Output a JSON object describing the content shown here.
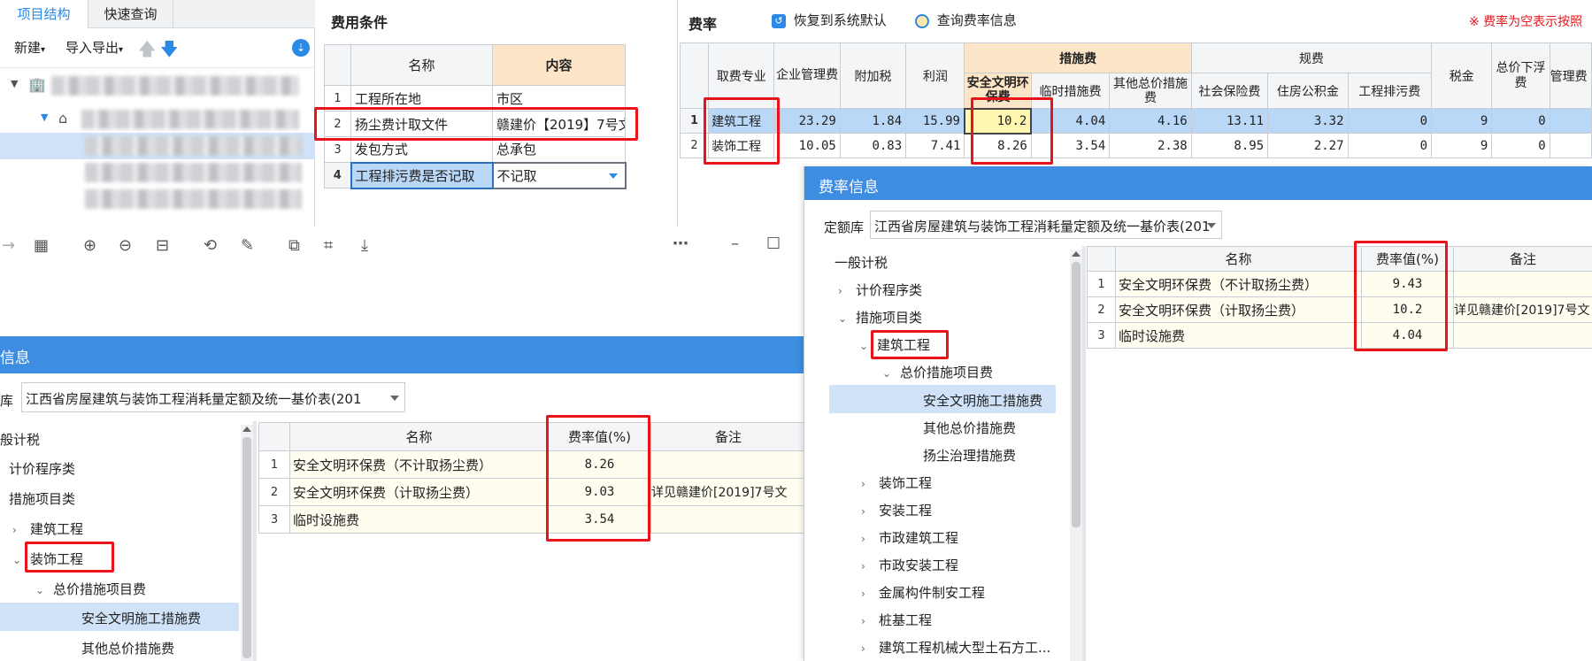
{
  "left_panel": {
    "tabs": [
      "项目结构",
      "快速查询"
    ],
    "toolbar": {
      "new": "新建",
      "import_export": "导入导出"
    }
  },
  "fee_conditions": {
    "title": "费用条件",
    "headers": [
      "名称",
      "内容"
    ],
    "rows": [
      {
        "n": "1",
        "name": "工程所在地",
        "value": "市区"
      },
      {
        "n": "2",
        "name": "扬尘费计取文件",
        "value": "赣建价【2019】7号文"
      },
      {
        "n": "3",
        "name": "发包方式",
        "value": "总承包"
      },
      {
        "n": "4",
        "name": "工程排污费是否记取",
        "value": "不记取"
      }
    ]
  },
  "rates": {
    "title": "费率",
    "restore_default": "恢复到系统默认",
    "query_info": "查询费率信息",
    "note": "※ 费率为空表示按照",
    "headers": {
      "category": "取费专业",
      "mgmt": "企业管理费",
      "surtax": "附加税",
      "profit": "利润",
      "measures_group": "措施费",
      "safety": "安全文明环保费",
      "temp": "临时措施费",
      "other_total": "其他总价措施费",
      "regulation_group": "规费",
      "social": "社会保险费",
      "housing": "住房公积金",
      "pollution": "工程排污费",
      "tax": "税金",
      "total_float": "总价下浮费",
      "mgmt2": "管理费"
    },
    "rows": [
      {
        "n": "1",
        "category": "建筑工程",
        "mgmt": "23.29",
        "surtax": "1.84",
        "profit": "15.99",
        "safety": "10.2",
        "temp": "4.04",
        "other_total": "4.16",
        "social": "13.11",
        "housing": "3.32",
        "pollution": "0",
        "tax": "9",
        "total_float": "0"
      },
      {
        "n": "2",
        "category": "装饰工程",
        "mgmt": "10.05",
        "surtax": "0.83",
        "profit": "7.41",
        "safety": "8.26",
        "temp": "3.54",
        "other_total": "2.38",
        "social": "8.95",
        "housing": "2.27",
        "pollution": "0",
        "tax": "9",
        "total_float": "0"
      }
    ]
  },
  "rate_info_right": {
    "title": "费率信息",
    "quota_label": "定额库",
    "quota_value": "江西省房屋建筑与装饰工程消耗量定额及统一基价表(201",
    "tree": [
      "一般计税",
      "计价程序类",
      "措施项目类",
      "建筑工程",
      "总价措施项目费",
      "安全文明施工措施费",
      "其他总价措施费",
      "扬尘治理措施费",
      "装饰工程",
      "安装工程",
      "市政建筑工程",
      "市政安装工程",
      "金属构件制安工程",
      "桩基工程",
      "建筑工程机械大型土石方工..."
    ],
    "headers": [
      "名称",
      "费率值(%)",
      "备注"
    ],
    "rows": [
      {
        "n": "1",
        "name": "安全文明环保费（不计取扬尘费）",
        "rate": "9.43",
        "note": ""
      },
      {
        "n": "2",
        "name": "安全文明环保费（计取扬尘费）",
        "rate": "10.2",
        "note": "详见赣建价[2019]7号文"
      },
      {
        "n": "3",
        "name": "临时设施费",
        "rate": "4.04",
        "note": ""
      }
    ]
  },
  "rate_info_left": {
    "title": "信息",
    "quota_label": "库",
    "quota_value": "江西省房屋建筑与装饰工程消耗量定额及统一基价表(201",
    "tree": [
      "般计税",
      "计价程序类",
      "措施项目类",
      "建筑工程",
      "装饰工程",
      "总价措施项目费",
      "安全文明施工措施费",
      "其他总价措施费"
    ],
    "headers": [
      "名称",
      "费率值(%)",
      "备注"
    ],
    "rows": [
      {
        "n": "1",
        "name": "安全文明环保费（不计取扬尘费）",
        "rate": "8.26",
        "note": ""
      },
      {
        "n": "2",
        "name": "安全文明环保费（计取扬尘费）",
        "rate": "9.03",
        "note": "详见赣建价[2019]7号文"
      },
      {
        "n": "3",
        "name": "临时设施费",
        "rate": "3.54",
        "note": ""
      }
    ]
  },
  "colors": {
    "accent": "#2b8ae6",
    "highlight_red": "#e8141a",
    "header_orange": "#fde5c8",
    "selected_blue": "#b9d7f6"
  }
}
